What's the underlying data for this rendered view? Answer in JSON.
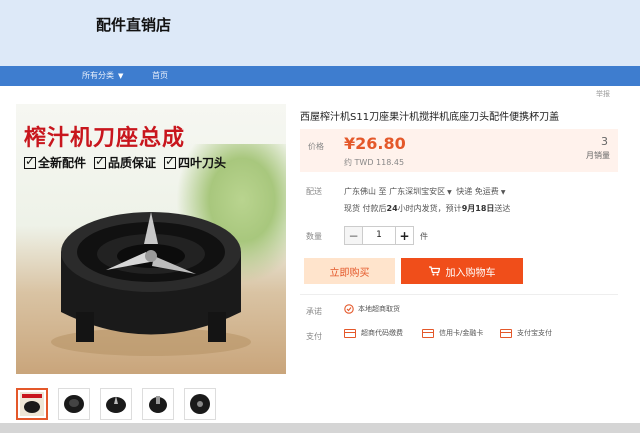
{
  "store": {
    "name": "配件直销店"
  },
  "nav": {
    "categories_label": "所有分类",
    "home_label": "首页"
  },
  "report_label": "举报",
  "gallery": {
    "overlay_title": "榨汁机刀座总成",
    "features": [
      "全新配件",
      "品质保证",
      "四叶刀头"
    ],
    "thumbnail_count": 5
  },
  "product": {
    "title": "西屋榨汁机S11刀座果汁机搅拌机底座刀头配件便携杯刀盖",
    "price_label": "价格",
    "price": "¥26.80",
    "price_twd": "约 TWD 118.45",
    "sold_count": "3",
    "sold_label": "月销量"
  },
  "shipping": {
    "label": "配送",
    "from": "广东佛山",
    "to_word": "至",
    "to": "广东深圳宝安区",
    "express": "快递 免运费",
    "stock_prefix": "现货 付款后",
    "stock_hours": "24",
    "stock_mid": "小时内发货，预计",
    "stock_date": "9月18日",
    "stock_suffix": "送达"
  },
  "quantity": {
    "label": "数量",
    "value": "1",
    "unit": "件",
    "minus": "−",
    "plus": "+"
  },
  "actions": {
    "buy_now": "立即购买",
    "add_to_cart": "加入购物车"
  },
  "guarantee": {
    "label": "承诺",
    "text": "本地超商取货"
  },
  "payment": {
    "label": "支付",
    "methods": [
      "超商代码缴费",
      "信用卡/金融卡",
      "支付宝支付"
    ]
  },
  "colors": {
    "accent": "#e4582a",
    "cart_button": "#f04e1a",
    "nav": "#3e7dcf",
    "header_bg": "#dde9f8",
    "title_red": "#c8161d"
  }
}
